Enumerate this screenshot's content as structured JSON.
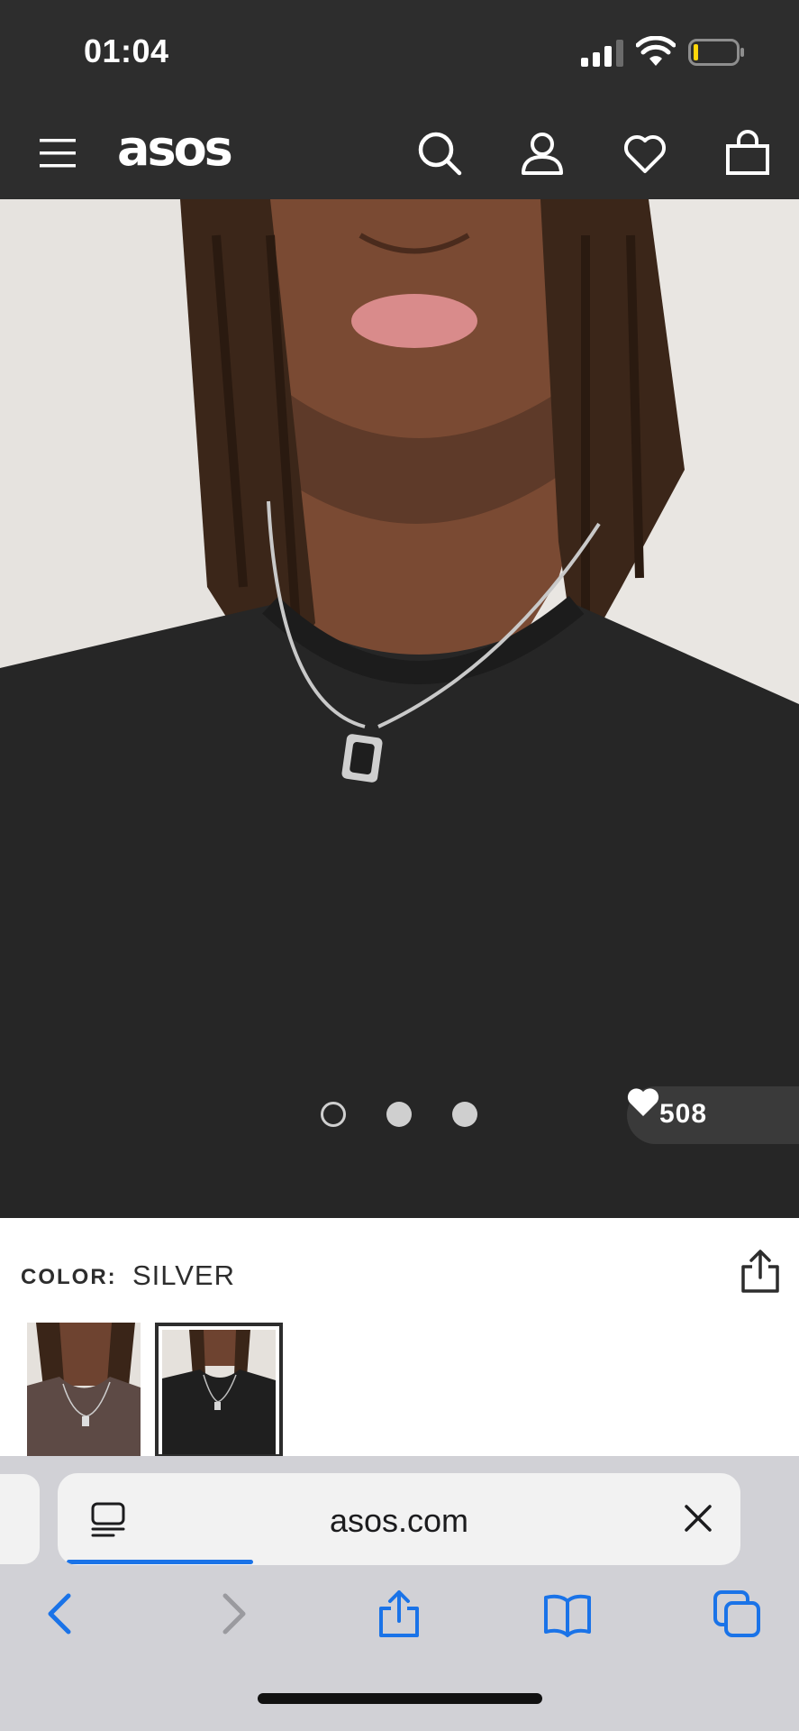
{
  "status_bar": {
    "time": "01:04",
    "signal_icon": "cellular-signal-icon",
    "wifi_icon": "wifi-icon",
    "battery_icon": "battery-low-icon",
    "battery_level": 0.1
  },
  "header": {
    "logo": "asos",
    "menu_icon": "hamburger-menu-icon",
    "search_icon": "search-icon",
    "account_icon": "account-icon",
    "saved_icon": "heart-icon",
    "bag_icon": "shopping-bag-icon"
  },
  "gallery": {
    "image_count": 3,
    "active_index": 0,
    "likes_count": "508",
    "likes_icon": "heart-filled-icon"
  },
  "product": {
    "color_label": "COLOR:",
    "color_value": "SILVER",
    "share_icon": "share-icon",
    "thumbnails_selected_index": 1
  },
  "browser": {
    "url": "asos.com",
    "reader_icon": "page-menu-icon",
    "close_icon": "close-icon",
    "load_progress": 0.28,
    "toolbar": {
      "back_icon": "chevron-left-icon",
      "forward_icon": "chevron-right-icon",
      "share_icon": "share-icon",
      "bookmarks_icon": "book-icon",
      "tabs_icon": "tabs-icon"
    }
  },
  "colors": {
    "header_bg": "#2d2d2d",
    "accent_blue": "#1a73e8",
    "toolbar_icon": "#1a73e8",
    "battery_low": "#ffd60a"
  }
}
